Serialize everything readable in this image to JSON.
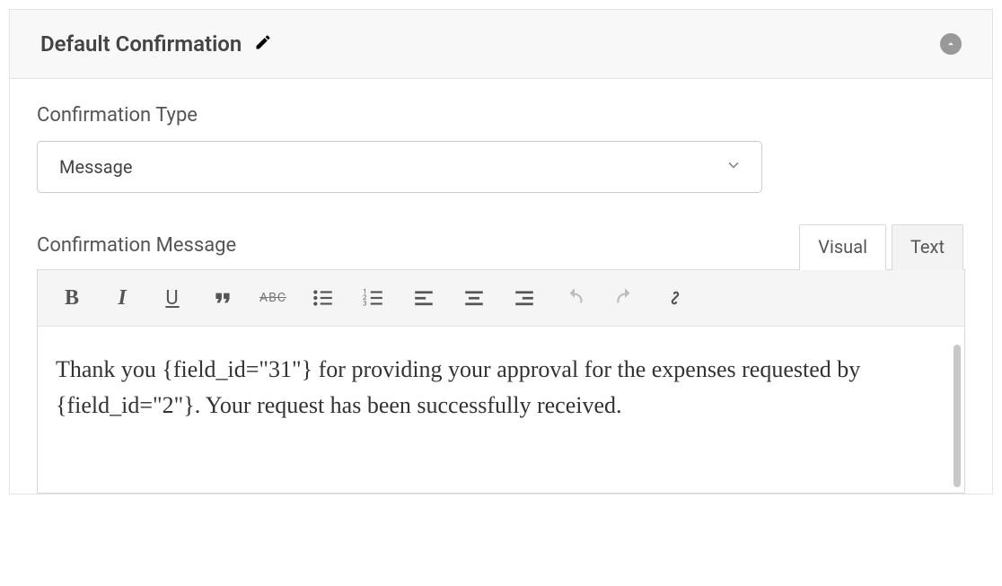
{
  "panel": {
    "title": "Default Confirmation"
  },
  "fields": {
    "type_label": "Confirmation Type",
    "type_value": "Message",
    "message_label": "Confirmation Message"
  },
  "tabs": {
    "visual": "Visual",
    "text": "Text"
  },
  "toolbar": {
    "bold": "B",
    "italic": "I",
    "underline": "U",
    "strike": "ABC"
  },
  "editor": {
    "content": "Thank you {field_id=\"31\"}  for providing your approval for the expenses requested by {field_id=\"2\"}. Your request has been successfully received."
  }
}
